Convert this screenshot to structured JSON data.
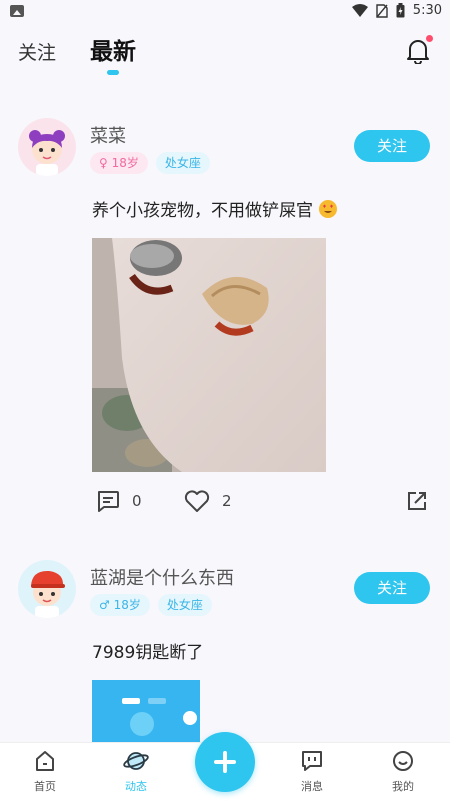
{
  "status_bar": {
    "time": "5:30"
  },
  "top_nav": {
    "tab_follow": "关注",
    "tab_latest": "最新"
  },
  "posts": [
    {
      "username": "菜菜",
      "gender_age": "18岁",
      "zodiac": "处女座",
      "follow_label": "关注",
      "text": "养个小孩宠物，不用做铲屎官",
      "comments": "0",
      "likes": "2"
    },
    {
      "username": "蓝湖是个什么东西",
      "gender_age": "18岁",
      "zodiac": "处女座",
      "follow_label": "关注",
      "text": "7989钥匙断了"
    }
  ],
  "bottom_nav": {
    "home": "首页",
    "feed": "动态",
    "messages": "消息",
    "mine": "我的"
  },
  "colors": {
    "accent": "#2ec5ee",
    "female": "#f06a9f",
    "male": "#3bb6e6"
  }
}
